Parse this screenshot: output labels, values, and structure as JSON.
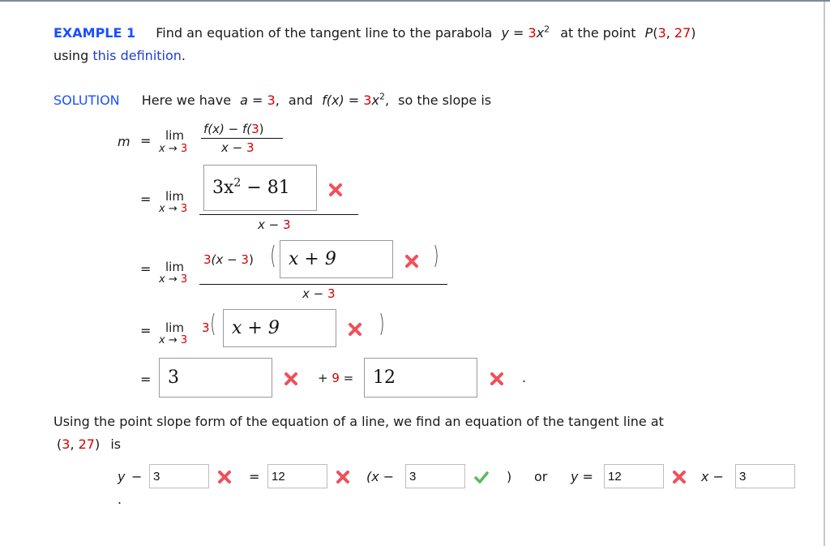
{
  "header": {
    "example_label": "EXAMPLE 1",
    "problem_text_1": "Find an equation of the tangent line to the parabola",
    "equation_y": "y",
    "equation_eq": " = ",
    "equation_coef": "3",
    "equation_var": "x",
    "equation_exp": "2",
    "problem_text_2": "at the point",
    "point_label": "P",
    "point_open": "(",
    "point_x": "3",
    "point_sep": ", ",
    "point_y": "27",
    "point_close": ")",
    "line2_prefix": "using ",
    "definition_link": "this definition",
    "line2_suffix": "."
  },
  "solution": {
    "label": "SOLUTION",
    "intro_1": "Here we have",
    "a_var": "a",
    "a_eq": " = ",
    "a_val": "3",
    "comma1": ",",
    "and": "and",
    "fx": "f(x)",
    "fx_eq": " = ",
    "fx_coef": "3",
    "fx_var": "x",
    "fx_exp": "2",
    "comma2": ",",
    "intro_2": "so the slope is"
  },
  "steps": {
    "m_label": "m",
    "equals": "=",
    "lim": "lim",
    "lim_sub_var": "x → ",
    "lim_sub_val": "3",
    "step1": {
      "num_a": "f(x) − f(",
      "num_b": "3",
      "num_c": ")",
      "den_a": "x − ",
      "den_b": "3"
    },
    "step2": {
      "input_value": "3x² − 81",
      "input_base": "3x",
      "input_exp": "2",
      "input_rest": " − 81",
      "status": "incorrect",
      "den_a": "x − ",
      "den_b": "3"
    },
    "step3": {
      "prefix_coef": "3",
      "prefix_a": "(x − ",
      "prefix_b": "3",
      "prefix_c": ")",
      "open_paren": "(",
      "input_value": "x + 9",
      "status": "incorrect",
      "close_paren": ")",
      "den_a": "x − ",
      "den_b": "3"
    },
    "step4": {
      "coef": "3",
      "open_paren": "(",
      "input_value": "x + 9",
      "status": "incorrect",
      "close_paren": ")"
    },
    "step5": {
      "input1_value": "3",
      "input1_status": "incorrect",
      "plus": "+ ",
      "plus_val": "9",
      "eq": " =",
      "input2_value": "12",
      "input2_status": "incorrect",
      "period": "."
    }
  },
  "tangent": {
    "text_1": "Using the point slope form of the equation of a line, we find an equation of the tangent line at",
    "pt_open": "(",
    "pt_x": "3",
    "pt_sep": ", ",
    "pt_y": "27",
    "pt_close": ")",
    "is": "is",
    "y_label": "y",
    "minus": "−",
    "input_y1_value": "3",
    "input_y1_status": "incorrect",
    "eq": "=",
    "input_m_value": "12",
    "input_m_status": "incorrect",
    "open": "(x −",
    "input_x1_value": "3",
    "input_x1_status": "correct",
    "close": ")",
    "or": "or",
    "y_eq": "y =",
    "input_slope_value": "12",
    "input_slope_status": "incorrect",
    "x_minus": "x −",
    "input_intercept_value": "3",
    "period": "."
  },
  "colors": {
    "accent_blue": "#1a4fff",
    "highlight_red": "#d40000",
    "incorrect_mark": "#f0505a",
    "correct_mark": "#5cb85c"
  }
}
